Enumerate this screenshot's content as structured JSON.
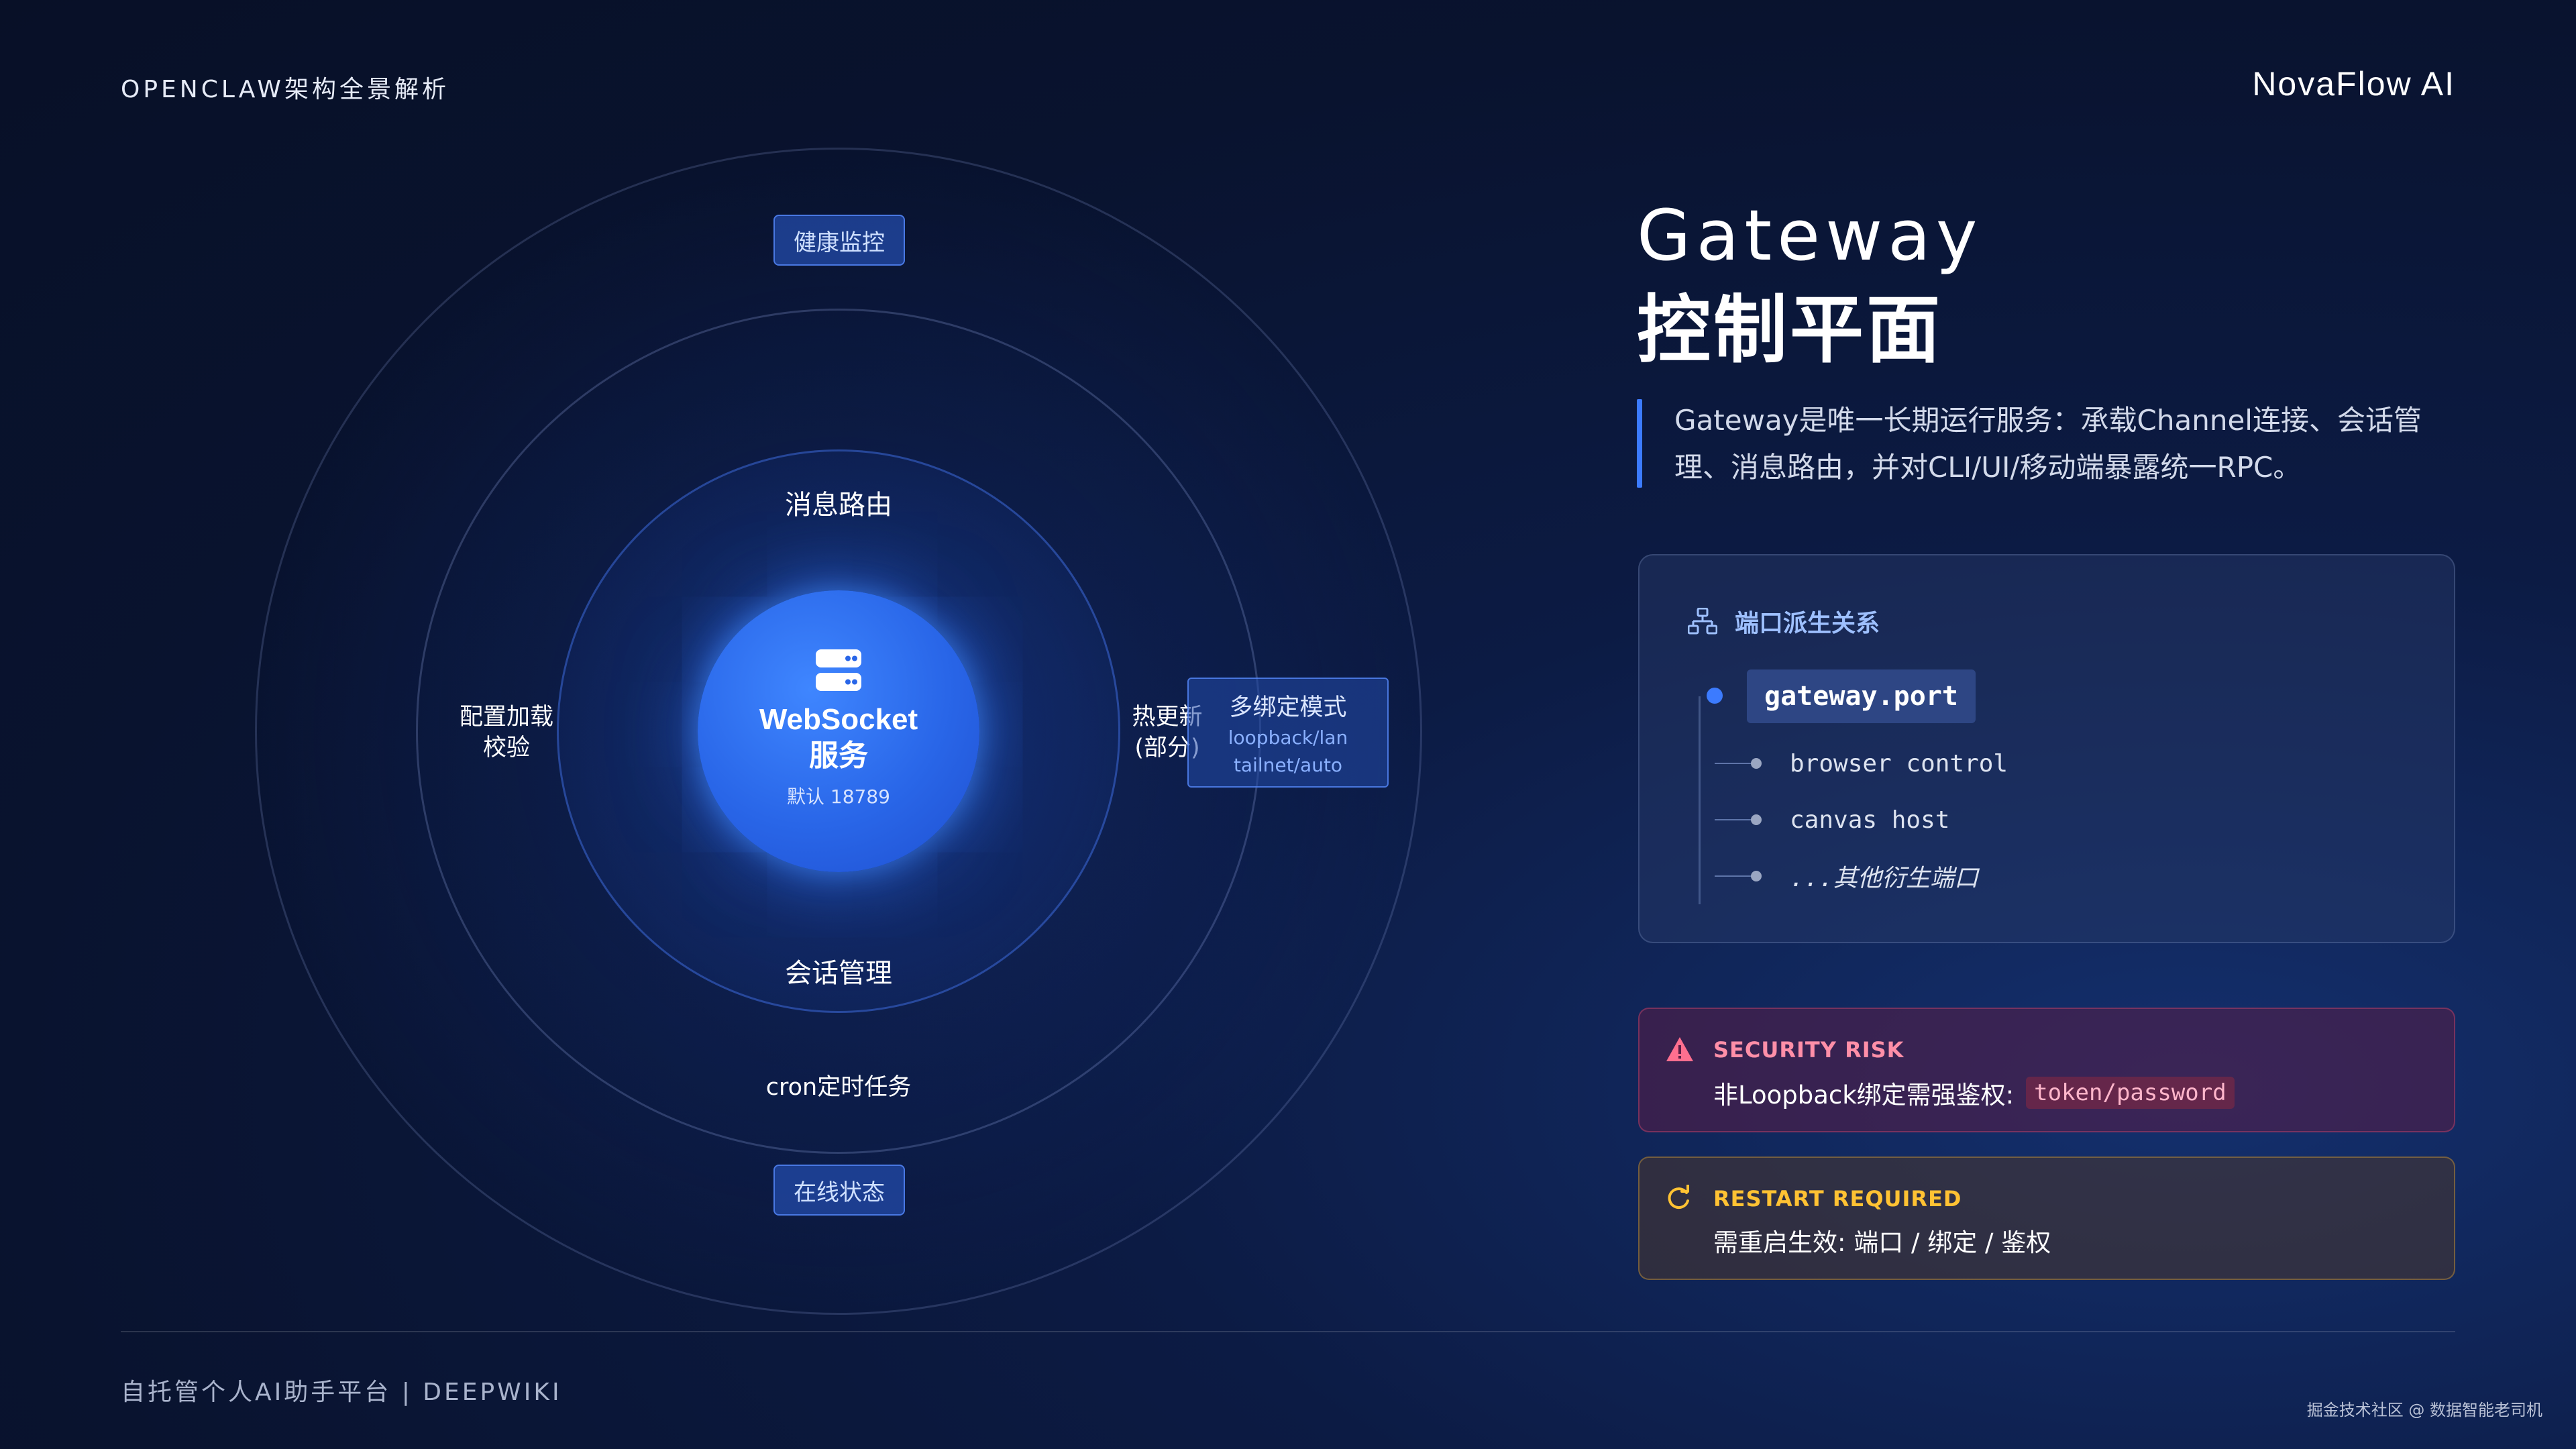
{
  "header": {
    "brand_left": "OPENCLAW架构全景解析",
    "brand_right": "NovaFlow AI"
  },
  "footer": {
    "left": "自托管个人AI助手平台 | DEEPWIKI",
    "watermark": "掘金技术社区 @ 数据智能老司机"
  },
  "diagram": {
    "core": {
      "icon": "server-icon",
      "title_line1": "WebSocket",
      "title_line2": "服务",
      "subtitle": "默认 18789"
    },
    "inner_ring": {
      "top": "消息路由",
      "bottom": "会话管理"
    },
    "middle_ring": {
      "left_line1": "配置加载",
      "left_line2": "校验",
      "right_line1": "热更新",
      "right_line2": "(部分)",
      "bottom": "cron定时任务"
    },
    "outer_ring": {
      "top_chip": "健康监控",
      "bottom_chip": "在线状态"
    },
    "bind_box": {
      "title": "多绑定模式",
      "line1": "loopback/lan",
      "line2": "tailnet/auto"
    }
  },
  "panel": {
    "title_en": "Gateway",
    "title_zh": "控制平面",
    "description": "Gateway是唯一长期运行服务：承载Channel连接、会话管理、消息路由，并对CLI/UI/移动端暴露统一RPC。",
    "port_card": {
      "icon": "sitemap-icon",
      "heading": "端口派生关系",
      "main_port": "gateway.port",
      "derived": [
        "browser control",
        "canvas host",
        "...其他衍生端口"
      ]
    },
    "security": {
      "icon": "warning-icon",
      "heading": "SECURITY RISK",
      "text": "非Loopback绑定需强鉴权:",
      "code": "token/password",
      "color": "#ff6f8f"
    },
    "restart": {
      "icon": "refresh-icon",
      "heading": "RESTART REQUIRED",
      "text": "需重启生效: 端口 / 绑定 / 鉴权",
      "color": "#ffc233"
    }
  },
  "colors": {
    "accent": "#3c7bff",
    "core": "#2966e8",
    "background": "#0a1430"
  }
}
